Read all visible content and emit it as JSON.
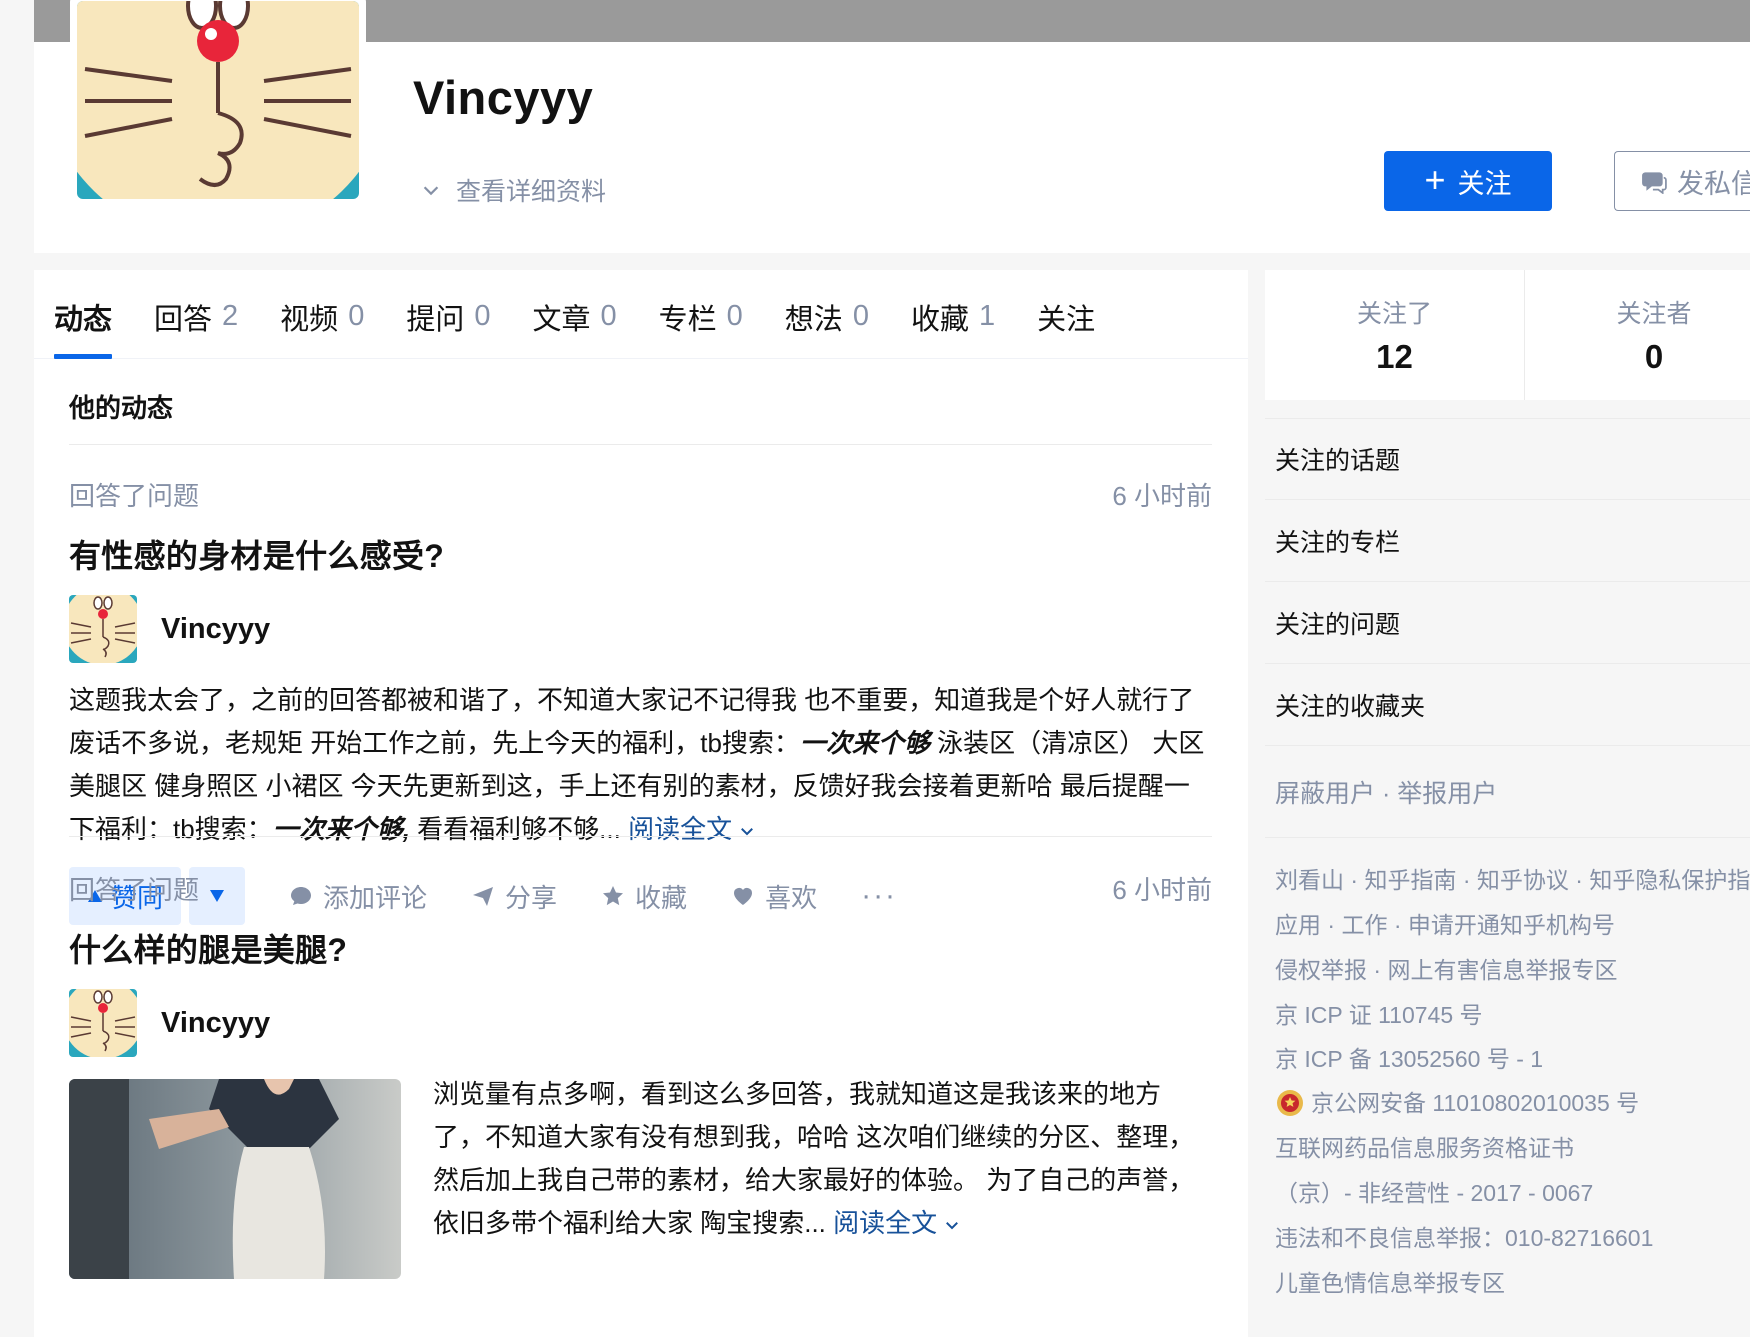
{
  "profile": {
    "name": "Vincyyy",
    "detail_link": "查看详细资料",
    "follow_label": "关注",
    "message_label": "发私信"
  },
  "tabs": [
    {
      "label": "动态",
      "count": ""
    },
    {
      "label": "回答",
      "count": "2"
    },
    {
      "label": "视频",
      "count": "0"
    },
    {
      "label": "提问",
      "count": "0"
    },
    {
      "label": "文章",
      "count": "0"
    },
    {
      "label": "专栏",
      "count": "0"
    },
    {
      "label": "想法",
      "count": "0"
    },
    {
      "label": "收藏",
      "count": "1"
    },
    {
      "label": "关注",
      "count": ""
    }
  ],
  "feed": {
    "section_title": "他的动态",
    "items": [
      {
        "action": "回答了问题",
        "time": "6 小时前",
        "title": "有性感的身材是什么感受?",
        "author": "Vincyyy",
        "excerpt_1": "这题我太会了，之前的回答都被和谐了，不知道大家记不记得我 也不重要，知道我是个好人就行了 废话不多说，老规矩 开始工作之前，先上今天的福利，tb搜索：",
        "excerpt_em_1": "一次来个够",
        "excerpt_2": " 泳装区（清凉区） 大区 美腿区 健身照区 小裙区 今天先更新到这，手上还有别的素材，反馈好我会接着更新哈 最后提醒一下福利：tb搜索：",
        "excerpt_em_2": "一次来个够,",
        "excerpt_3": " 看看福利够不够...",
        "read_more": "阅读全文"
      },
      {
        "action": "回答了问题",
        "time": "6 小时前",
        "title": "什么样的腿是美腿?",
        "author": "Vincyyy",
        "excerpt": "浏览量有点多啊，看到这么多回答，我就知道这是我该来的地方了，不知道大家有没有想到我，哈哈 这次咱们继续的分区、整理，然后加上我自己带的素材，给大家最好的体验。 为了自己的声誉，依旧多带个福利给大家 陶宝搜索...",
        "read_more": "阅读全文"
      }
    ],
    "actions": {
      "upvote": "赞同",
      "comment": "添加评论",
      "share": "分享",
      "favorite": "收藏",
      "like": "喜欢",
      "more": "···"
    }
  },
  "stats": {
    "following_label": "关注了",
    "following_value": "12",
    "followers_label": "关注者",
    "followers_value": "0"
  },
  "side_links": [
    "关注的话题",
    "关注的专栏",
    "关注的问题",
    "关注的收藏夹"
  ],
  "block_report": "屏蔽用户 · 举报用户",
  "footer": {
    "line1": "刘看山 · 知乎指南 · 知乎协议 · 知乎隐私保护指",
    "line2": "应用 · 工作 · 申请开通知乎机构号",
    "line3": "侵权举报 · 网上有害信息举报专区",
    "line4": "京 ICP 证 110745 号",
    "line5": "京 ICP 备 13052560 号 - 1",
    "line6": "京公网安备 11010802010035 号",
    "line7": "互联网药品信息服务资格证书",
    "line8": "（京）- 非经营性 - 2017 - 0067",
    "line9": "违法和不良信息举报：010-82716601",
    "line10": "儿童色情信息举报专区"
  },
  "colors": {
    "brand_blue": "#0a66e8",
    "muted_gray": "#8590a6",
    "link_blue": "#175199"
  }
}
